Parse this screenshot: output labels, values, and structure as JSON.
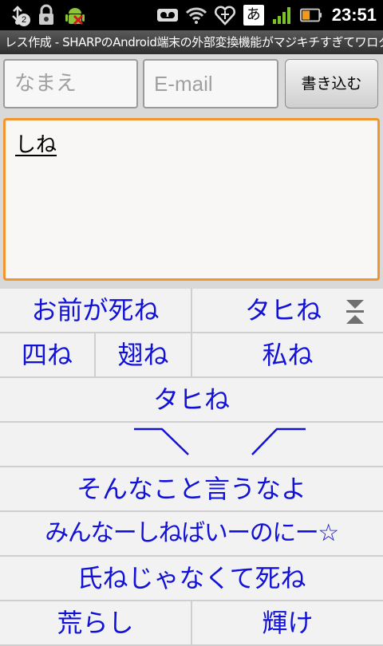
{
  "status_bar": {
    "icons": [
      "usb-debug-icon",
      "lock-icon",
      "android-icon",
      "voicemail-icon",
      "wifi-icon",
      "heart-icon",
      "ime-icon",
      "signal-icon",
      "battery-icon"
    ],
    "notification_count": "2",
    "ime_label": "あ",
    "time": "23:51"
  },
  "title_bar": {
    "title": "レス作成 - SHARPのAndroid端末の外部変換機能がマジキチすぎてワロタwww"
  },
  "form": {
    "name_placeholder": "なまえ",
    "email_placeholder": "E-mail",
    "submit_label": "書き込む",
    "body_value": "しね"
  },
  "candidates": {
    "row1": [
      "お前が死ね",
      "タヒね"
    ],
    "row2": [
      "四ね",
      "翅ね",
      "私ね"
    ],
    "row3": "タヒね",
    "row4_ascii": "＿/  \\＿",
    "row5": "そんなこと言うなよ",
    "row6": "みんなーしねばいーのにー☆",
    "row7": "氏ねじゃなくて死ね",
    "row8": [
      "荒らし",
      "輝け"
    ]
  },
  "colors": {
    "candidate_text": "#1212d6",
    "focus_border": "#f0962e",
    "status_bar_bg": "#000000"
  }
}
